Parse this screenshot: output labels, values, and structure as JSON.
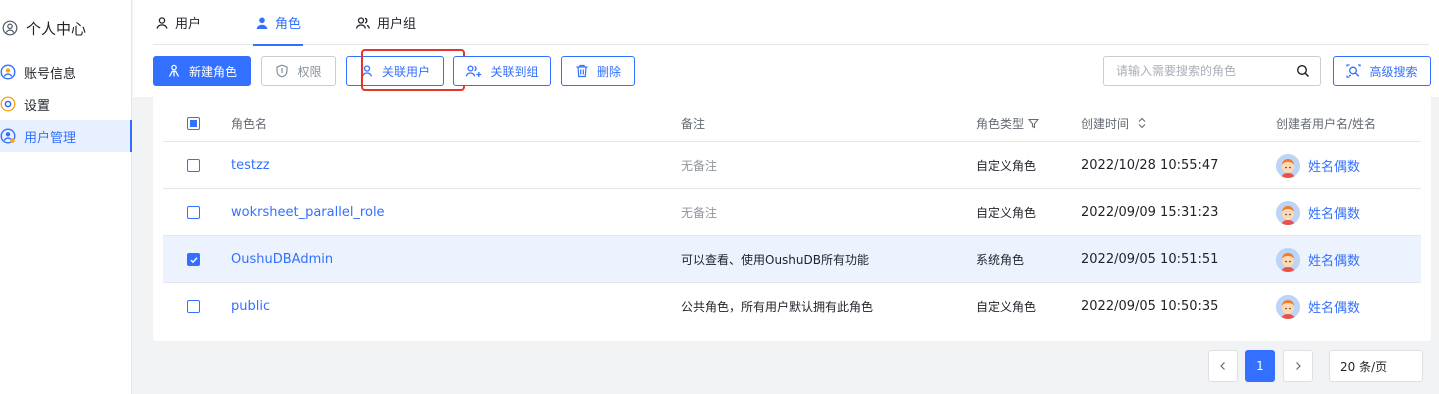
{
  "sidebar": {
    "title": "个人中心",
    "items": [
      {
        "label": "账号信息",
        "icon": "account-icon"
      },
      {
        "label": "设置",
        "icon": "settings-icon"
      },
      {
        "label": "用户管理",
        "icon": "user-manage-icon",
        "active": true
      }
    ]
  },
  "tabs": [
    {
      "label": "用户",
      "icon": "user-icon"
    },
    {
      "label": "角色",
      "icon": "role-icon",
      "active": true
    },
    {
      "label": "用户组",
      "icon": "group-icon"
    }
  ],
  "toolbar": {
    "new_role": "新建角色",
    "permission": "权限",
    "link_user": "关联用户",
    "link_group": "关联到组",
    "delete": "删除",
    "search_placeholder": "请输入需要搜索的角色",
    "advanced_search": "高级搜索"
  },
  "table": {
    "headers": {
      "name": "角色名",
      "note": "备注",
      "type": "角色类型",
      "created": "创建时间",
      "creator": "创建者用户名/姓名"
    },
    "rows": [
      {
        "name": "testzz",
        "note": "无备注",
        "note_empty": true,
        "type": "自定义角色",
        "created": "2022/10/28 10:55:47",
        "creator": "姓名偶数",
        "checked": false
      },
      {
        "name": "wokrsheet_parallel_role",
        "note": "无备注",
        "note_empty": true,
        "type": "自定义角色",
        "created": "2022/09/09 15:31:23",
        "creator": "姓名偶数",
        "checked": false
      },
      {
        "name": "OushuDBAdmin",
        "note": "可以查看、使用OushuDB所有功能",
        "note_empty": false,
        "type": "系统角色",
        "created": "2022/09/05 10:51:51",
        "creator": "姓名偶数",
        "checked": true
      },
      {
        "name": "public",
        "note": "公共角色，所有用户默认拥有此角色",
        "note_empty": false,
        "type": "自定义角色",
        "created": "2022/09/05 10:50:35",
        "creator": "姓名偶数",
        "checked": false
      }
    ]
  },
  "pagination": {
    "current_page": "1",
    "page_size": "20 条/页"
  },
  "colors": {
    "accent": "#3370ff",
    "highlight": "#e5352a",
    "selected_row": "#edf3fe"
  }
}
